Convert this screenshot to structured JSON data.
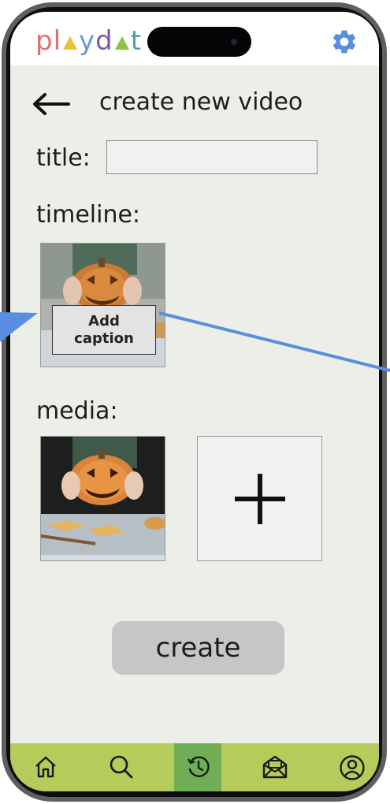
{
  "app": {
    "logo_letters": [
      "p",
      "l",
      "y",
      "d",
      "t"
    ],
    "logo_colors": {
      "p": "#df6f6b",
      "l": "#df6f6b",
      "y": "#6f98d8",
      "d": "#7c56a8",
      "t": "#4aa0b8",
      "tri1": "#e6c437",
      "tri2": "#8dc247"
    },
    "settings_icon": "gear-icon",
    "accent": "#5a8ee0"
  },
  "header": {
    "back_icon": "arrow-left-icon",
    "title": "create new video"
  },
  "form": {
    "title_label": "title:",
    "title_value": "",
    "timeline_label": "timeline:",
    "add_caption_line1": "Add",
    "add_caption_line2": "caption",
    "media_label": "media:",
    "add_media_icon": "plus-icon",
    "create_label": "create"
  },
  "navbar": {
    "items": [
      {
        "icon": "home-icon",
        "active": false
      },
      {
        "icon": "search-icon",
        "active": false
      },
      {
        "icon": "history-icon",
        "active": true
      },
      {
        "icon": "inbox-icon",
        "active": false
      },
      {
        "icon": "profile-icon",
        "active": false
      }
    ],
    "bar_color": "#b5cb5a",
    "active_color": "#6fae55"
  }
}
